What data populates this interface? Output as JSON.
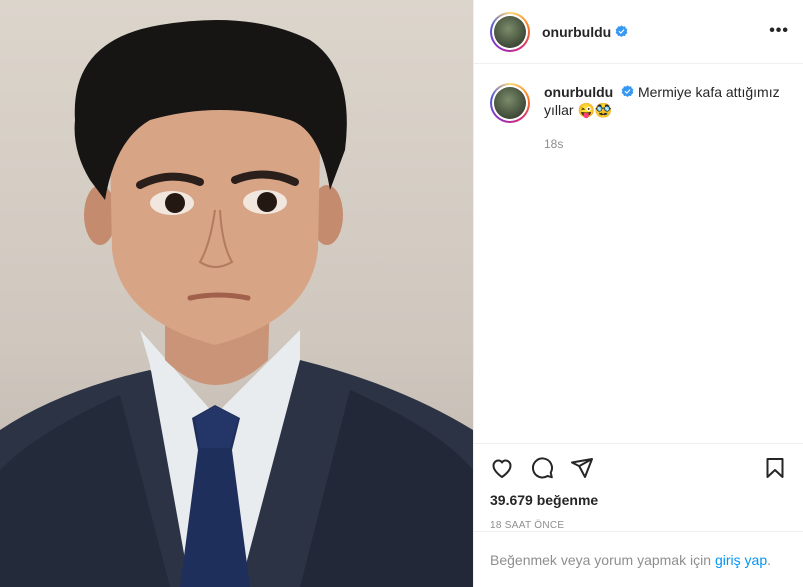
{
  "post": {
    "username": "onurbuldu",
    "caption": "Mermiye kafa attığımız yıllar 😜🥸",
    "comment_time": "18s",
    "likes_label": "39.679 beğenme",
    "time_ago": "18 SAAT ÖNCE"
  },
  "header": {
    "more_label": "•••"
  },
  "footer": {
    "prompt": "Beğenmek veya yorum yapmak için",
    "login_link": "giriş yap",
    "end": "."
  },
  "colors": {
    "link": "#0095f6",
    "verified": "#3897f0",
    "muted": "#8e8e8e"
  },
  "icons": [
    "heart-icon",
    "comment-icon",
    "share-icon",
    "bookmark-icon",
    "verified-icon",
    "more-icon"
  ]
}
